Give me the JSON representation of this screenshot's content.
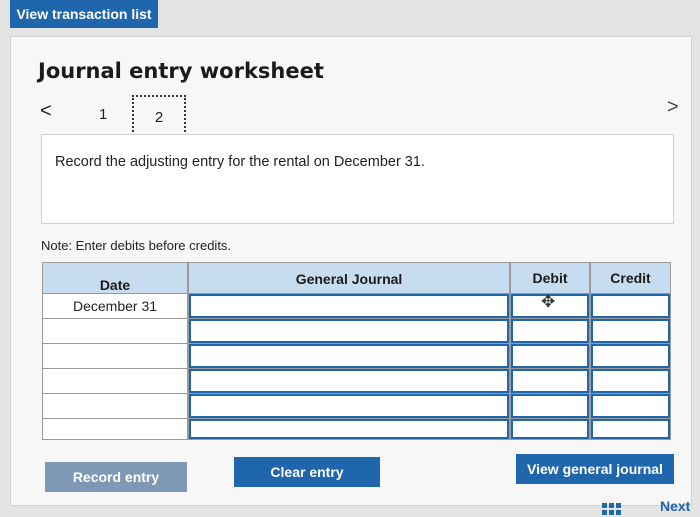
{
  "header": {
    "view_transactions_label": "View transaction list"
  },
  "worksheet": {
    "title": "Journal entry worksheet",
    "pages": [
      "1",
      "2"
    ],
    "current_page": "2",
    "prev_icon": "<",
    "next_icon": ">",
    "instruction": "Record the adjusting entry for the rental on December 31.",
    "note": "Note: Enter debits before credits."
  },
  "table": {
    "columns": [
      "Date",
      "General Journal",
      "Debit",
      "Credit"
    ],
    "rows": [
      {
        "date": "December 31",
        "account": "",
        "debit": "",
        "credit": ""
      },
      {
        "date": "",
        "account": "",
        "debit": "",
        "credit": ""
      },
      {
        "date": "",
        "account": "",
        "debit": "",
        "credit": ""
      },
      {
        "date": "",
        "account": "",
        "debit": "",
        "credit": ""
      },
      {
        "date": "",
        "account": "",
        "debit": "",
        "credit": ""
      },
      {
        "date": "",
        "account": "",
        "debit": "",
        "credit": ""
      }
    ]
  },
  "buttons": {
    "record_entry": "Record entry",
    "clear_entry": "Clear entry",
    "view_general_journal": "View general journal"
  },
  "footer": {
    "next_label": "Next"
  },
  "colors": {
    "primary": "#1f66ad",
    "disabled": "#7f98b6",
    "header_bg": "#c8dcef"
  }
}
